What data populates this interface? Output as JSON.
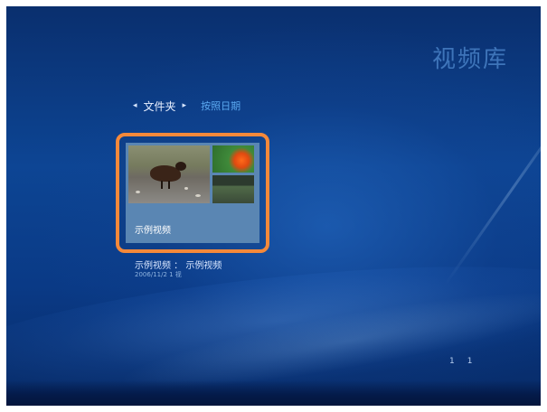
{
  "header": {
    "title": "视频库"
  },
  "nav": {
    "folder_label": "文件夹",
    "sort_label": "按照日期",
    "left_arrow": "◂",
    "right_arrow": "▸"
  },
  "gallery": {
    "items": [
      {
        "thumb_label": "示例视频",
        "title": "示例视频 ： 示例视频",
        "date": "2006/11/2 1 视"
      }
    ]
  },
  "pager": {
    "left": "1",
    "right": "1"
  },
  "colors": {
    "focus_border": "#f5893a",
    "background": "#0d4594",
    "accent_text": "#5aa8f0"
  },
  "icons": [
    "left-arrow-icon",
    "right-arrow-icon"
  ]
}
